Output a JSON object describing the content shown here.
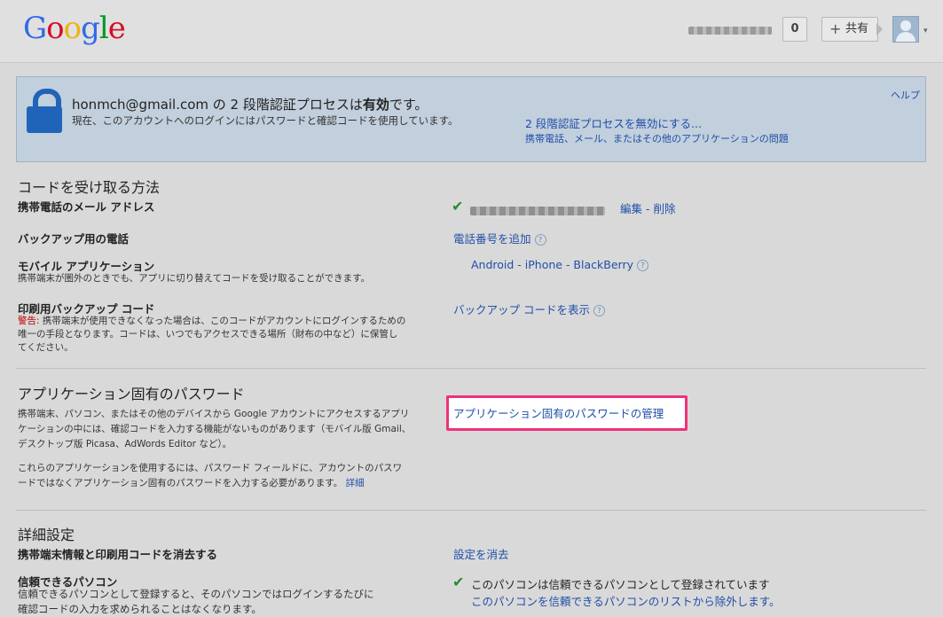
{
  "header": {
    "logo": {
      "G": "G",
      "o1": "o",
      "o2": "o",
      "g": "g",
      "l": "l",
      "e": "e"
    },
    "notification_count": "0",
    "share_label": "共有",
    "share_plus": "+",
    "avatar_caret": "▾"
  },
  "banner": {
    "title_prefix": "honmch@gmail.com の 2 段階認証プロセスは",
    "title_bold": "有効",
    "title_suffix": "です。",
    "subtitle": "現在、このアカウントへのログインにはパスワードと確認コードを使用しています。",
    "disable_link": "2 段階認証プロセスを無効にする...",
    "problems_link": "携帯電話、メール、またはその他のアプリケーションの問題",
    "help_link": "ヘルプ"
  },
  "receive_section": {
    "title": "コードを受け取る方法",
    "mobile_email": {
      "label": "携帯電話のメール アドレス",
      "edit": "編集",
      "sep": " - ",
      "delete": "削除",
      "check": "✔"
    },
    "backup_phone": {
      "label": "バックアップ用の電話",
      "action": "電話番号を追加",
      "help": "?"
    },
    "mobile_app": {
      "label": "モバイル アプリケーション",
      "desc": "携帯端末が圏外のときでも、アプリに切り替えてコードを受け取ることができます。",
      "action": "Android - iPhone - BlackBerry",
      "help": "?"
    },
    "printed_codes": {
      "label": "印刷用バックアップ コード",
      "warn": "警告:",
      "desc_line1": " 携帯端末が使用できなくなった場合は、このコードがアカウントにログインするための",
      "desc_line2": "唯一の手段となります。コードは、いつでもアクセスできる場所（財布の中など）に保管し",
      "desc_line3": "てください。",
      "action": "バックアップ コードを表示",
      "help": "?"
    }
  },
  "app_password_section": {
    "title": "アプリケーション固有のパスワード",
    "desc1_line1": "携帯端末、パソコン、またはその他のデバイスから Google アカウントにアクセスするアプリ",
    "desc1_line2": "ケーションの中には、確認コードを入力する機能がないものがあります（モバイル版 Gmail、",
    "desc1_line3": "デスクトップ版 Picasa、AdWords Editor など）。",
    "desc2_line1": "これらのアプリケーションを使用するには、パスワード フィールドに、アカウントのパスワ",
    "desc2_line2": "ードではなくアプリケーション固有のパスワードを入力する必要があります。",
    "details_link": "詳細",
    "manage_link": "アプリケーション固有のパスワードの管理"
  },
  "advanced_section": {
    "title": "詳細設定",
    "clear": {
      "label": "携帯端末情報と印刷用コードを消去する",
      "action": "設定を消去"
    },
    "trusted": {
      "label": "信頼できるパソコン",
      "desc_line1": "信頼できるパソコンとして登録すると、そのパソコンではログインするたびに",
      "desc_line2": "確認コードの入力を求められることはなくなります。",
      "status": "このパソコンは信頼できるパソコンとして登録されています",
      "remove_link": "このパソコンを信頼できるパソコンのリストから除外します。",
      "check": "✔"
    }
  }
}
